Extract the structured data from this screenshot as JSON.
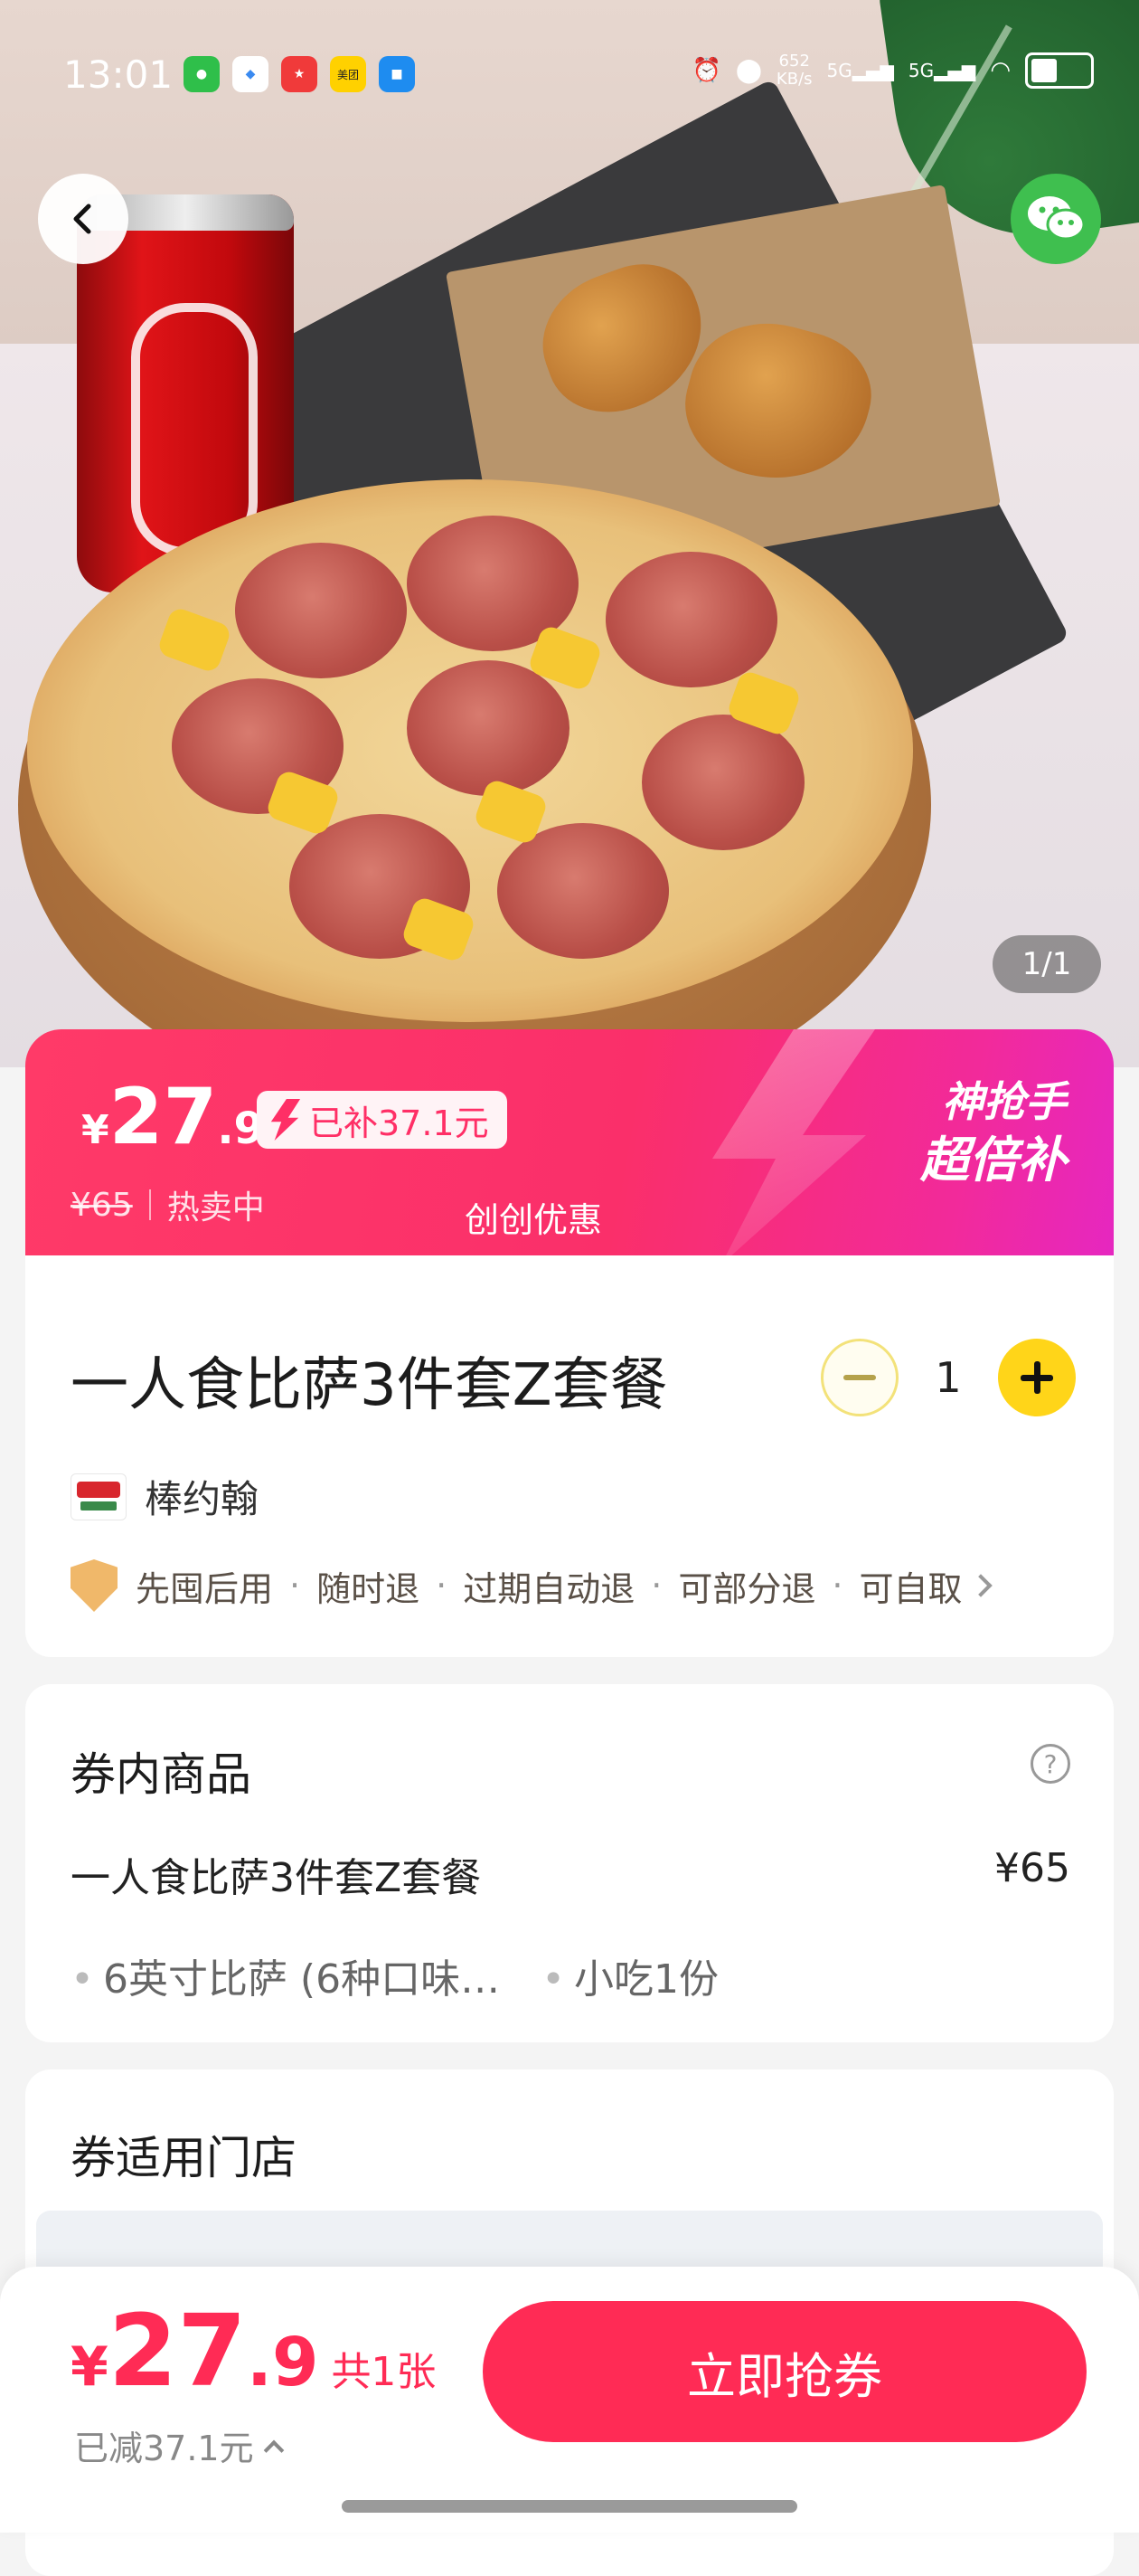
{
  "status_bar": {
    "time": "13:01",
    "speed_value": "652",
    "speed_unit": "KB/s",
    "sig1": "5G",
    "sig2": "5G",
    "app_icons": [
      "wechat-icon",
      "qq-icon",
      "app-icon",
      "meituan-icon",
      "app-icon-blue"
    ],
    "meituan_label": "美团"
  },
  "hero": {
    "image_counter": "1/1",
    "back_icon": "chevron-left-icon",
    "share_icon": "wechat-icon"
  },
  "price_banner": {
    "currency": "¥",
    "price_int": "27",
    "price_dec": ".9",
    "subsidy": "已补37.1元",
    "original_price": "¥65",
    "status": "热卖中",
    "brand_promo": "创创优惠",
    "campaign_line1": "神抢手",
    "campaign_line2": "超倍补"
  },
  "product": {
    "title": "一人食比萨3件套Z套餐",
    "quantity": "1",
    "shop_name": "棒约翰",
    "guarantees": [
      "先囤后用",
      "随时退",
      "过期自动退",
      "可部分退",
      "可自取"
    ],
    "guarantee_sep": "·"
  },
  "coupon_items": {
    "header": "券内商品",
    "help": "?",
    "item_name": "一人食比萨3件套Z套餐",
    "item_price": "¥65",
    "sub_items": [
      "6英寸比萨 (6种口味…",
      "小吃1份"
    ]
  },
  "stores": {
    "header": "券适用门店"
  },
  "bottom_bar": {
    "currency": "¥",
    "price_int": "27",
    "price_dec": ".9",
    "count": "共1张",
    "saved": "已减37.1元",
    "cta": "立即抢券"
  },
  "colors": {
    "accent": "#ff2b55",
    "banner_start": "#ff3a68",
    "banner_end": "#e627c0",
    "plus_button": "#ffd519"
  }
}
